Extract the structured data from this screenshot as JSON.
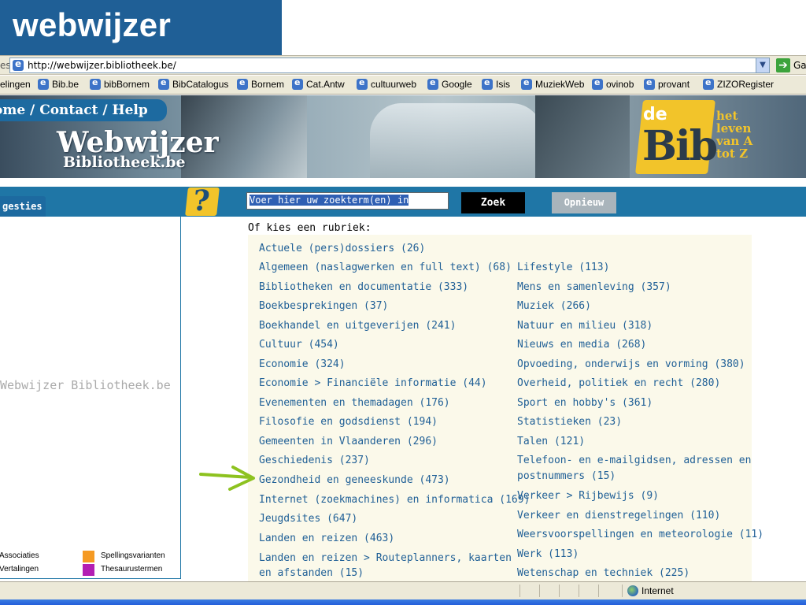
{
  "slide": {
    "title": "webwijzer"
  },
  "browser": {
    "address_left_text": "es",
    "url": "http://webwijzer.bibliotheek.be/",
    "go_label": "Ga",
    "links": [
      "elingen",
      "Bib.be",
      "bibBornem",
      "BibCatalogus",
      "Bornem",
      "Cat.Antw",
      "cultuurweb",
      "Google",
      "Isis",
      "MuziekWeb",
      "ovinob",
      "provant",
      "ZIZORegister"
    ],
    "status_zone": "Internet"
  },
  "site": {
    "nav": "ome / Contact / Help",
    "logo_main": "Webwijzer",
    "logo_sub": "Bibliotheek.be",
    "badge_de": "de",
    "badge_word": "Bib",
    "badge_tagline": [
      "het",
      "leven",
      "van A",
      "tot Z"
    ],
    "suggesties_tab": "gesties",
    "help_icon": "?",
    "search_placeholder": "Voer hier uw zoekterm(en) in",
    "search_button": "Zoek",
    "reset_button": "Opnieuw",
    "watermark": "Webwijzer Bibliotheek.be",
    "legend": [
      "Associaties",
      "Spellingsvarianten",
      "Vertalingen",
      "Thesaurustermen"
    ],
    "legend_colors": [
      "#f59a23",
      "#b31fb3"
    ],
    "rubriek_label": "Of kies een rubriek:",
    "categories_left": [
      "Actuele (pers)dossiers (26)",
      "Algemeen (naslagwerken en full text) (68)",
      "Bibliotheken en documentatie (333)",
      "Boekbesprekingen (37)",
      "Boekhandel en uitgeverijen (241)",
      "Cultuur (454)",
      "Economie (324)",
      "Economie > Financiële informatie (44)",
      "Evenementen en themadagen (176)",
      "Filosofie en godsdienst (194)",
      "Gemeenten in Vlaanderen (296)",
      "Geschiedenis (237)",
      "Gezondheid en geneeskunde (473)",
      "Internet (zoekmachines) en informatica (169)",
      "Jeugdsites (647)",
      "Landen en reizen (463)",
      "Landen en reizen > Routeplanners, kaarten",
      "en afstanden (15)"
    ],
    "categories_right": [
      "Lifestyle (113)",
      "Mens en samenleving (357)",
      "Muziek (266)",
      "Natuur en milieu (318)",
      "Nieuws en media (268)",
      "Opvoeding, onderwijs en vorming (380)",
      "Overheid, politiek en recht (280)",
      "Sport en hobby's (361)",
      "Statistieken (23)",
      "Talen (121)",
      "Telefoon- en e-mailgidsen, adressen en",
      "postnummers (15)",
      "Verkeer > Rijbewijs (9)",
      "Verkeer en dienstregelingen (110)",
      "Weersvoorspellingen en meteorologie (11)",
      "Werk (113)",
      "Wetenschap en techniek (225)"
    ]
  },
  "colors": {
    "accent": "#1f76a6",
    "link": "#1f5f96",
    "arrow": "#8dc21f",
    "badge": "#f2c42a"
  }
}
